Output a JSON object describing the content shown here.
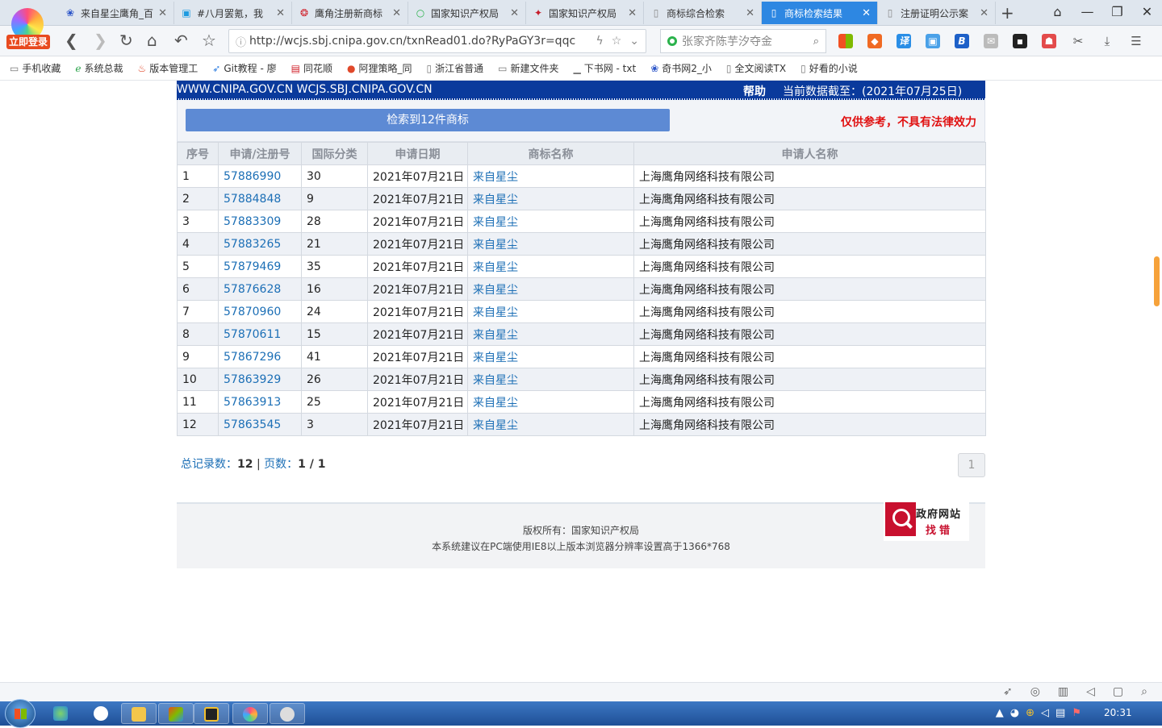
{
  "browser": {
    "login_badge": "立即登录",
    "tabs": [
      {
        "label": "来自星尘鹰角_百",
        "icon": "paw-icon",
        "active": false
      },
      {
        "label": "#八月罢氪，我",
        "icon": "tv-icon",
        "active": false
      },
      {
        "label": "鹰角注册新商标",
        "icon": "news-icon",
        "active": false
      },
      {
        "label": "国家知识产权局",
        "icon": "search-icon",
        "active": false
      },
      {
        "label": "国家知识产权局",
        "icon": "scale-icon",
        "active": false
      },
      {
        "label": "商标综合检索",
        "icon": "page-icon",
        "active": false
      },
      {
        "label": "商标检索结果",
        "icon": "page-icon",
        "active": true
      },
      {
        "label": "注册证明公示案",
        "icon": "page-icon",
        "active": false
      }
    ],
    "url": "http://wcjs.sbj.cnipa.gov.cn/txnRead01.do?RyPaGY3r=qqc",
    "search_value": "张家齐陈芋汐夺金",
    "bookmarks": [
      "手机收藏",
      "系统总裁",
      "版本管理工",
      "Git教程 - 廖",
      "同花顺",
      "阿狸策略_同",
      "浙江省普通",
      "新建文件夹",
      "下书网 - txt",
      "奇书网2_小",
      "全文阅读TX",
      "好看的小说"
    ]
  },
  "header": {
    "site": "WWW.CNIPA.GOV.CN WCJS.SBJ.CNIPA.GOV.CN",
    "help": "帮助",
    "date_label": "当前数据截至：(2021年07月25日)"
  },
  "result": {
    "count_label": "检索到12件商标",
    "disclaimer": "仅供参考，不具有法律效力"
  },
  "table": {
    "columns": [
      "序号",
      "申请/注册号",
      "国际分类",
      "申请日期",
      "商标名称",
      "申请人名称"
    ],
    "rows": [
      {
        "no": "1",
        "reg": "57886990",
        "cls": "30",
        "date": "2021年07月21日",
        "name": "来自星尘",
        "applicant": "上海鹰角网络科技有限公司"
      },
      {
        "no": "2",
        "reg": "57884848",
        "cls": "9",
        "date": "2021年07月21日",
        "name": "来自星尘",
        "applicant": "上海鹰角网络科技有限公司"
      },
      {
        "no": "3",
        "reg": "57883309",
        "cls": "28",
        "date": "2021年07月21日",
        "name": "来自星尘",
        "applicant": "上海鹰角网络科技有限公司"
      },
      {
        "no": "4",
        "reg": "57883265",
        "cls": "21",
        "date": "2021年07月21日",
        "name": "来自星尘",
        "applicant": "上海鹰角网络科技有限公司"
      },
      {
        "no": "5",
        "reg": "57879469",
        "cls": "35",
        "date": "2021年07月21日",
        "name": "来自星尘",
        "applicant": "上海鹰角网络科技有限公司"
      },
      {
        "no": "6",
        "reg": "57876628",
        "cls": "16",
        "date": "2021年07月21日",
        "name": "来自星尘",
        "applicant": "上海鹰角网络科技有限公司"
      },
      {
        "no": "7",
        "reg": "57870960",
        "cls": "24",
        "date": "2021年07月21日",
        "name": "来自星尘",
        "applicant": "上海鹰角网络科技有限公司"
      },
      {
        "no": "8",
        "reg": "57870611",
        "cls": "15",
        "date": "2021年07月21日",
        "name": "来自星尘",
        "applicant": "上海鹰角网络科技有限公司"
      },
      {
        "no": "9",
        "reg": "57867296",
        "cls": "41",
        "date": "2021年07月21日",
        "name": "来自星尘",
        "applicant": "上海鹰角网络科技有限公司"
      },
      {
        "no": "10",
        "reg": "57863929",
        "cls": "26",
        "date": "2021年07月21日",
        "name": "来自星尘",
        "applicant": "上海鹰角网络科技有限公司"
      },
      {
        "no": "11",
        "reg": "57863913",
        "cls": "25",
        "date": "2021年07月21日",
        "name": "来自星尘",
        "applicant": "上海鹰角网络科技有限公司"
      },
      {
        "no": "12",
        "reg": "57863545",
        "cls": "3",
        "date": "2021年07月21日",
        "name": "来自星尘",
        "applicant": "上海鹰角网络科技有限公司"
      }
    ]
  },
  "pager": {
    "total_label": "总记录数：",
    "total": "12",
    "pages_label": "页数：",
    "pages": "1 / 1",
    "current_page": "1"
  },
  "footer": {
    "copyright": "版权所有：国家知识产权局",
    "note": "本系统建议在PC端使用IE8以上版本浏览器分辨率设置高于1366*768",
    "gov_line1": "政府网站",
    "gov_line2": "找错"
  },
  "taskbar": {
    "clock": "20:31"
  },
  "colors": {
    "banner": "#0a3a9c",
    "result_button": "#5d8ad4",
    "link": "#1c6fb6",
    "disclaimer": "#e01010",
    "active_tab": "#2d87e2"
  }
}
